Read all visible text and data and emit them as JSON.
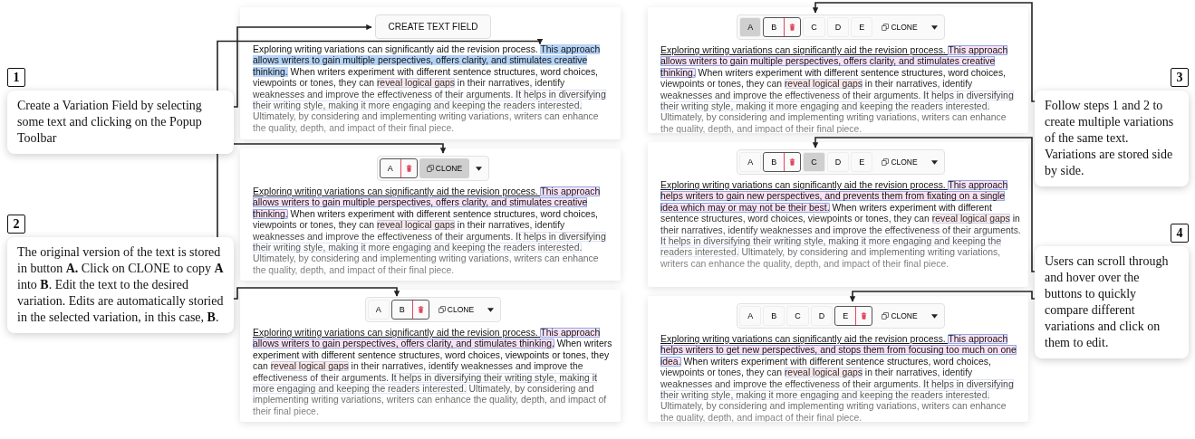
{
  "left_column": {
    "panels": [
      {
        "toolbar": {
          "kind": "create",
          "label": "CREATE TEXT FIELD"
        },
        "paragraph": [
          {
            "kind": "plain",
            "text": "Exploring writing variations can significantly aid the revision process. "
          },
          {
            "kind": "selection",
            "text": "This approach allows writers to gain multiple perspectives, offers clarity, and stimulates creative thinking."
          },
          {
            "kind": "plain",
            "text": " When writers experiment with different sentence structures, word choices, viewpoints or tones, they can "
          },
          {
            "kind": "comment",
            "text": "reveal logical gaps"
          },
          {
            "kind": "plain",
            "text": " in their narratives, identify weaknesses and improve the effectiveness of their arguments. "
          },
          {
            "kind": "field",
            "text": "It helps in diversifying their writing style, making it more engaging and keeping the readers interested."
          },
          {
            "kind": "plain",
            "text": " Ultimately, by considering and implementing writing variations, writers can enhance the quality, depth, and impact of their final piece."
          }
        ]
      },
      {
        "toolbar": {
          "kind": "variations",
          "buttons": [
            {
              "label": "A",
              "selected": true,
              "hovered": false
            }
          ],
          "clone": {
            "label": "CLONE",
            "hovered": true
          }
        },
        "paragraph": [
          {
            "kind": "underlined",
            "text": "Exploring writing variations can significantly aid the revision process. "
          },
          {
            "kind": "variation",
            "text": "This approach allows writers to gain multiple perspectives, offers clarity, and stimulates creative thinking."
          },
          {
            "kind": "plain",
            "text": " When writers experiment with different sentence structures, word choices, viewpoints or tones, they can "
          },
          {
            "kind": "comment",
            "text": "reveal logical gaps"
          },
          {
            "kind": "plain",
            "text": " in their narratives, identify weaknesses and improve the effectiveness of their arguments. "
          },
          {
            "kind": "field",
            "text": "It helps in diversifying their writing style, making it more engaging and keeping the readers interested."
          },
          {
            "kind": "plain",
            "text": " Ultimately, by considering and implementing writing variations, writers can enhance the quality, depth, and impact of their final piece."
          }
        ]
      },
      {
        "toolbar": {
          "kind": "variations",
          "buttons": [
            {
              "label": "A",
              "selected": false,
              "hovered": false
            },
            {
              "label": "B",
              "selected": true,
              "hovered": false
            }
          ],
          "clone": {
            "label": "CLONE",
            "hovered": false
          }
        },
        "paragraph": [
          {
            "kind": "underlined",
            "text": "Exploring writing variations can significantly aid the revision process. "
          },
          {
            "kind": "variation",
            "text": "This approach allows writers to gain perspectives, offers clarity, and stimulates thinking."
          },
          {
            "kind": "plain",
            "text": " When writers experiment with different sentence structures, word choices, viewpoints or tones, they can "
          },
          {
            "kind": "comment",
            "text": "reveal logical gaps"
          },
          {
            "kind": "plain",
            "text": " in their narratives, identify weaknesses and improve the effectiveness of their arguments. "
          },
          {
            "kind": "field",
            "text": "It helps in diversifying their writing style, making it more engaging and keeping the readers interested."
          },
          {
            "kind": "plain",
            "text": " Ultimately, by considering and implementing writing variations, writers can enhance the quality, depth, and impact of their final piece."
          }
        ]
      }
    ]
  },
  "right_column": {
    "panels": [
      {
        "toolbar": {
          "kind": "variations",
          "buttons": [
            {
              "label": "A",
              "selected": false,
              "hovered": true
            },
            {
              "label": "B",
              "selected": true,
              "hovered": false
            },
            {
              "label": "C",
              "selected": false,
              "hovered": false
            },
            {
              "label": "D",
              "selected": false,
              "hovered": false
            },
            {
              "label": "E",
              "selected": false,
              "hovered": false
            }
          ],
          "clone": {
            "label": "CLONE",
            "hovered": false
          }
        },
        "paragraph": [
          {
            "kind": "underlined",
            "text": "Exploring writing variations can significantly aid the revision process. "
          },
          {
            "kind": "variation",
            "text": "This approach allows writers to gain multiple perspectives, offers clarity, and stimulates creative thinking."
          },
          {
            "kind": "plain",
            "text": " When writers experiment with different sentence structures, word choices, viewpoints or tones, they can "
          },
          {
            "kind": "comment",
            "text": "reveal logical gaps"
          },
          {
            "kind": "plain",
            "text": " in their narratives, identify weaknesses and improve the effectiveness of their arguments. "
          },
          {
            "kind": "field",
            "text": "It helps in diversifying their writing style, making it more engaging and keeping the readers interested."
          },
          {
            "kind": "plain",
            "text": " Ultimately, by considering and implementing writing variations, writers can enhance the quality, depth, and impact of their final piece."
          }
        ]
      },
      {
        "toolbar": {
          "kind": "variations",
          "buttons": [
            {
              "label": "A",
              "selected": false,
              "hovered": false
            },
            {
              "label": "B",
              "selected": true,
              "hovered": false
            },
            {
              "label": "C",
              "selected": false,
              "hovered": true
            },
            {
              "label": "D",
              "selected": false,
              "hovered": false
            },
            {
              "label": "E",
              "selected": false,
              "hovered": false
            }
          ],
          "clone": {
            "label": "CLONE",
            "hovered": false
          }
        },
        "paragraph": [
          {
            "kind": "underlined",
            "text": "Exploring writing variations can significantly aid the revision process. "
          },
          {
            "kind": "variation",
            "text": "This approach helps writers to gain new perspectives, and prevents them from fixating on a single idea which may or may not be their best."
          },
          {
            "kind": "plain",
            "text": " When writers experiment with different sentence structures, word choices, viewpoints or tones, they can "
          },
          {
            "kind": "comment",
            "text": "reveal logical gaps"
          },
          {
            "kind": "plain",
            "text": " in their narratives, identify weaknesses and improve the effectiveness of their arguments. "
          },
          {
            "kind": "field",
            "text": "It helps in diversifying their writing style, making it more engaging and keeping the readers interested."
          },
          {
            "kind": "plain",
            "text": " Ultimately, by considering and implementing writing variations, writers can enhance the quality, depth, and impact of their final piece."
          }
        ]
      },
      {
        "toolbar": {
          "kind": "variations",
          "buttons": [
            {
              "label": "A",
              "selected": false,
              "hovered": false
            },
            {
              "label": "B",
              "selected": false,
              "hovered": false
            },
            {
              "label": "C",
              "selected": false,
              "hovered": false
            },
            {
              "label": "D",
              "selected": false,
              "hovered": false
            },
            {
              "label": "E",
              "selected": true,
              "hovered": false
            }
          ],
          "clone": {
            "label": "CLONE",
            "hovered": false
          }
        },
        "paragraph": [
          {
            "kind": "underlined",
            "text": "Exploring writing variations can significantly aid the revision process. "
          },
          {
            "kind": "variation",
            "text": "This approach helps writers to get new perspectives, and stops them from focusing too much on one idea."
          },
          {
            "kind": "plain",
            "text": " When writers experiment with different sentence structures, word choices, viewpoints or tones, they can "
          },
          {
            "kind": "comment",
            "text": "reveal logical gaps"
          },
          {
            "kind": "plain",
            "text": " in their narratives, identify weaknesses and improve the effectiveness of their arguments. "
          },
          {
            "kind": "field",
            "text": "It helps in diversifying their writing style, making it more engaging and keeping the readers interested."
          },
          {
            "kind": "plain",
            "text": " Ultimately, by considering and implementing writing variations, writers can enhance the quality, depth, and impact of their final piece."
          }
        ]
      }
    ]
  },
  "callouts": [
    {
      "number": "1",
      "text": "Create a Variation Field by selecting some text and clicking on the Popup Toolbar"
    },
    {
      "number": "2",
      "text": "The original version of the text is stored in button **A.** Click on CLONE to copy **A** into **B**. Edit the text to the desired variation. Edits are automatically storied in the selected variation, in this case, **B**."
    },
    {
      "number": "3",
      "text": "Follow steps 1 and 2 to create multiple variations of the same text. Variations are stored side by side."
    },
    {
      "number": "4",
      "text": "Users can scroll through and hover over the buttons to quickly compare different variations and click on them to edit."
    }
  ]
}
